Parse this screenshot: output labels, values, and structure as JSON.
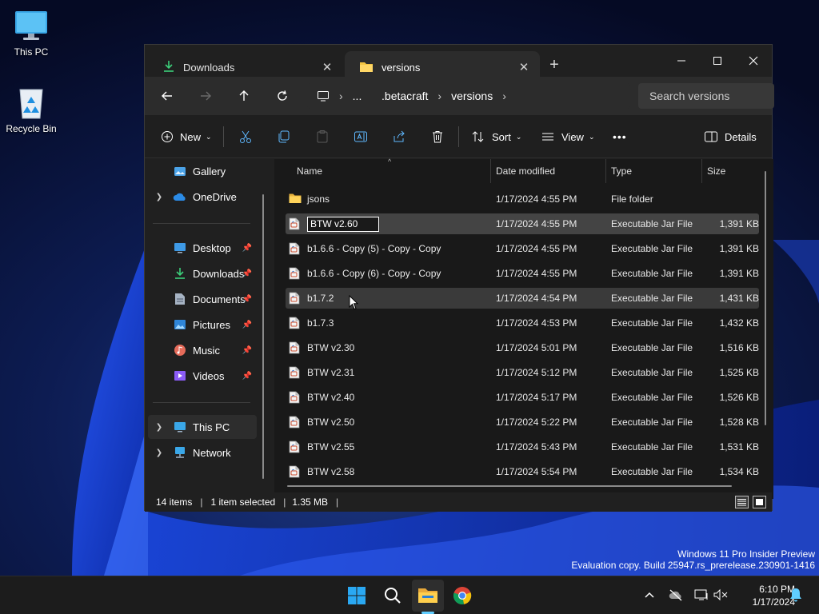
{
  "desktop": {
    "icons": [
      {
        "label": "This PC"
      },
      {
        "label": "Recycle Bin"
      }
    ]
  },
  "window": {
    "tabs": [
      {
        "label": "Downloads",
        "icon": "download-icon",
        "active": false
      },
      {
        "label": "versions",
        "icon": "folder-icon",
        "active": true
      }
    ],
    "new_tab_label": "+",
    "address": {
      "crumbs": [
        "...",
        ".betacraft",
        "versions"
      ]
    },
    "search": {
      "placeholder": "Search versions"
    },
    "commands": {
      "new_label": "New",
      "sort_label": "Sort",
      "view_label": "View",
      "details_label": "Details",
      "more_label": "•••"
    }
  },
  "sidebar": {
    "items": [
      {
        "label": "Gallery",
        "icon": "gallery-icon"
      },
      {
        "label": "OneDrive",
        "icon": "onedrive-icon"
      },
      {
        "label": "Desktop",
        "icon": "desktop-icon",
        "pinned": true
      },
      {
        "label": "Downloads",
        "icon": "download-icon",
        "pinned": true
      },
      {
        "label": "Documents",
        "icon": "documents-icon",
        "pinned": true
      },
      {
        "label": "Pictures",
        "icon": "pictures-icon",
        "pinned": true
      },
      {
        "label": "Music",
        "icon": "music-icon",
        "pinned": true
      },
      {
        "label": "Videos",
        "icon": "videos-icon",
        "pinned": true
      },
      {
        "label": "This PC",
        "icon": "this-pc-icon",
        "selected": true
      },
      {
        "label": "Network",
        "icon": "network-icon"
      }
    ]
  },
  "filelist": {
    "columns": [
      "Name",
      "Date modified",
      "Type",
      "Size"
    ],
    "rows": [
      {
        "name": "jsons",
        "date": "1/17/2024 4:55 PM",
        "type": "File folder",
        "size": "",
        "icon": "folder-icon"
      },
      {
        "name": "BTW v2.60",
        "date": "1/17/2024 4:55 PM",
        "type": "Executable Jar File",
        "size": "1,391 KB",
        "icon": "jar-icon",
        "selected": true,
        "renaming": true
      },
      {
        "name": "b1.6.6 - Copy (5) - Copy - Copy",
        "date": "1/17/2024 4:55 PM",
        "type": "Executable Jar File",
        "size": "1,391 KB",
        "icon": "jar-icon"
      },
      {
        "name": "b1.6.6 - Copy (6) - Copy - Copy",
        "date": "1/17/2024 4:55 PM",
        "type": "Executable Jar File",
        "size": "1,391 KB",
        "icon": "jar-icon"
      },
      {
        "name": "b1.7.2",
        "date": "1/17/2024 4:54 PM",
        "type": "Executable Jar File",
        "size": "1,431 KB",
        "icon": "jar-icon",
        "hover": true
      },
      {
        "name": "b1.7.3",
        "date": "1/17/2024 4:53 PM",
        "type": "Executable Jar File",
        "size": "1,432 KB",
        "icon": "jar-icon"
      },
      {
        "name": "BTW v2.30",
        "date": "1/17/2024 5:01 PM",
        "type": "Executable Jar File",
        "size": "1,516 KB",
        "icon": "jar-icon"
      },
      {
        "name": "BTW v2.31",
        "date": "1/17/2024 5:12 PM",
        "type": "Executable Jar File",
        "size": "1,525 KB",
        "icon": "jar-icon"
      },
      {
        "name": "BTW v2.40",
        "date": "1/17/2024 5:17 PM",
        "type": "Executable Jar File",
        "size": "1,526 KB",
        "icon": "jar-icon"
      },
      {
        "name": "BTW v2.50",
        "date": "1/17/2024 5:22 PM",
        "type": "Executable Jar File",
        "size": "1,528 KB",
        "icon": "jar-icon"
      },
      {
        "name": "BTW v2.55",
        "date": "1/17/2024 5:43 PM",
        "type": "Executable Jar File",
        "size": "1,531 KB",
        "icon": "jar-icon"
      },
      {
        "name": "BTW v2.58",
        "date": "1/17/2024 5:54 PM",
        "type": "Executable Jar File",
        "size": "1,534 KB",
        "icon": "jar-icon"
      }
    ]
  },
  "statusbar": {
    "item_count": "14 items",
    "selection": "1 item selected",
    "selection_size": "1.35 MB",
    "separator": "|"
  },
  "watermark": {
    "line1": "Windows 11 Pro Insider Preview",
    "line2": "Evaluation copy. Build 25947.rs_prerelease.230901-1416"
  },
  "taskbar": {
    "clock_time": "6:10 PM",
    "clock_date": "1/17/2024"
  },
  "colors": {
    "accent": "#60cdff",
    "window_bg": "#202020",
    "list_bg": "#191919",
    "selected_row": "#444444"
  }
}
